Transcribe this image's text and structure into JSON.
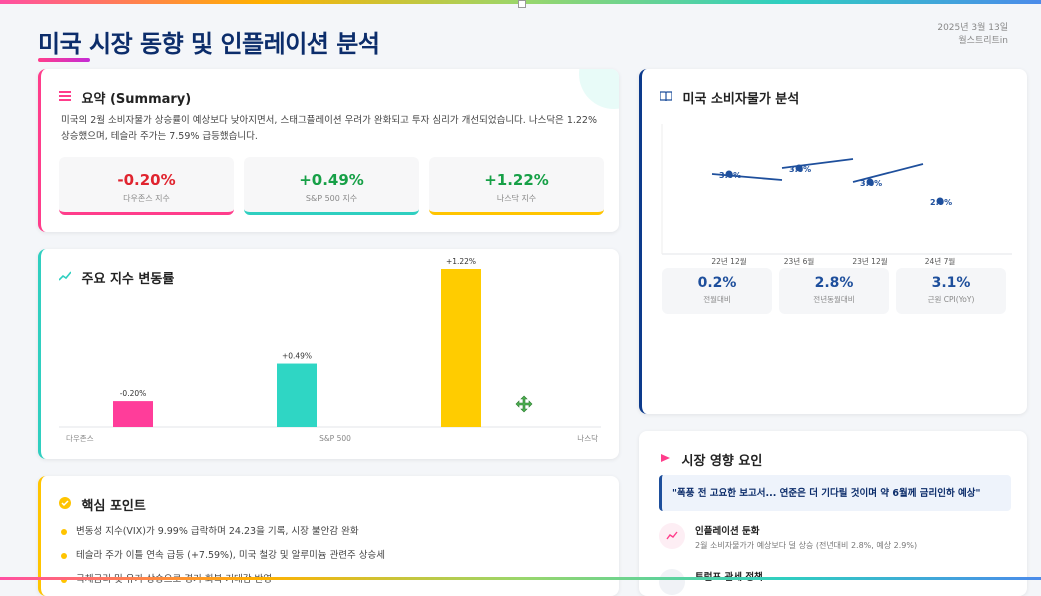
{
  "header": {
    "title": "미국 시장 동향 및 인플레이션 분석",
    "date": "2025년 3월 13일",
    "source": "월스트리트in"
  },
  "summary": {
    "title": "요약 (Summary)",
    "text": "미국의 2월 소비자물가 상승률이 예상보다 낮아지면서, 스태그플레이션 우려가 완화되고 투자 심리가 개선되었습니다. 나스닥은 1.22% 상승했으며, 테슬라 주가는 7.59% 급등했습니다.",
    "stats": [
      {
        "value": "-0.20%",
        "label": "다우존스 지수",
        "color": "#e0242f",
        "accent": "#ff3d8b"
      },
      {
        "value": "+0.49%",
        "label": "S&P 500 지수",
        "color": "#17a047",
        "accent": "#2fcfc0"
      },
      {
        "value": "+1.22%",
        "label": "나스닥 지수",
        "color": "#17a047",
        "accent": "#ffc400"
      }
    ]
  },
  "index_chart": {
    "title": "주요 지수 변동률"
  },
  "chart_data": [
    {
      "type": "bar",
      "categories": [
        "다우존스",
        "S&P 500",
        "나스닥"
      ],
      "values": [
        -0.2,
        0.49,
        1.22
      ],
      "data_labels": [
        "-0.20%",
        "+0.49%",
        "+1.22%"
      ],
      "colors": [
        "#ff3d9a",
        "#2fd6c4",
        "#ffcc00"
      ],
      "title": "주요 지수 변동률",
      "xlabel": "",
      "ylabel": "",
      "ylim": [
        0,
        1.22
      ],
      "grid": false
    },
    {
      "type": "line",
      "title": "미국 소비자물가 분석",
      "x": [
        "22년 12월",
        "23년 6월",
        "23년 12월",
        "24년 7월"
      ],
      "points": [
        {
          "x": "22년 12월",
          "y": 3.0,
          "label": "3.0%"
        },
        {
          "x": "23년 6월",
          "y": 3.0,
          "label": "3.0%"
        },
        {
          "x": "23년 12월",
          "y": 3.0,
          "label": "3.0%"
        },
        {
          "x": "24년 7월",
          "y": 2.9,
          "label": "2.9%"
        }
      ],
      "xlabel": "",
      "ylabel": ""
    }
  ],
  "key_points": {
    "title": "핵심 포인트",
    "items": [
      "변동성 지수(VIX)가 9.99% 급락하며 24.23을 기록, 시장 불안감 완화",
      "테슬라 주가 이틀 연속 급등 (+7.59%), 미국 철강 및 알루미늄 관련주 상승세",
      "국채금리 및 유가 상승으로 경기 회복 기대감 반영"
    ]
  },
  "cpi": {
    "title": "미국 소비자물가 분석",
    "stats": [
      {
        "value": "0.2%",
        "label": "전월대비"
      },
      {
        "value": "2.8%",
        "label": "전년동월대비"
      },
      {
        "value": "3.1%",
        "label": "근원 CPI(YoY)"
      }
    ]
  },
  "factors": {
    "title": "시장 영향 요인",
    "quote": "\"폭풍 전 고요한 보고서... 연준은 더 기다릴 것이며 약 6월께 금리인하 예상\"",
    "items": [
      {
        "title": "인플레이션 둔화",
        "desc": "2월 소비자물가가 예상보다 덜 상승 (전년대비 2.8%, 예상 2.9%)"
      },
      {
        "title": "트럼프 관세 정책",
        "desc": ""
      }
    ]
  },
  "colors": {
    "title": "#0c2d6b",
    "pink": "#ff3d8b",
    "teal": "#2fcfc0",
    "yellow": "#ffc400",
    "navy": "#1e4f9c"
  },
  "icons": {
    "summary": "list-icon",
    "index": "trend-icon",
    "key_points": "check-circle-icon",
    "cpi": "book-icon",
    "factors": "flag-icon",
    "move": "move-cursor-icon"
  }
}
